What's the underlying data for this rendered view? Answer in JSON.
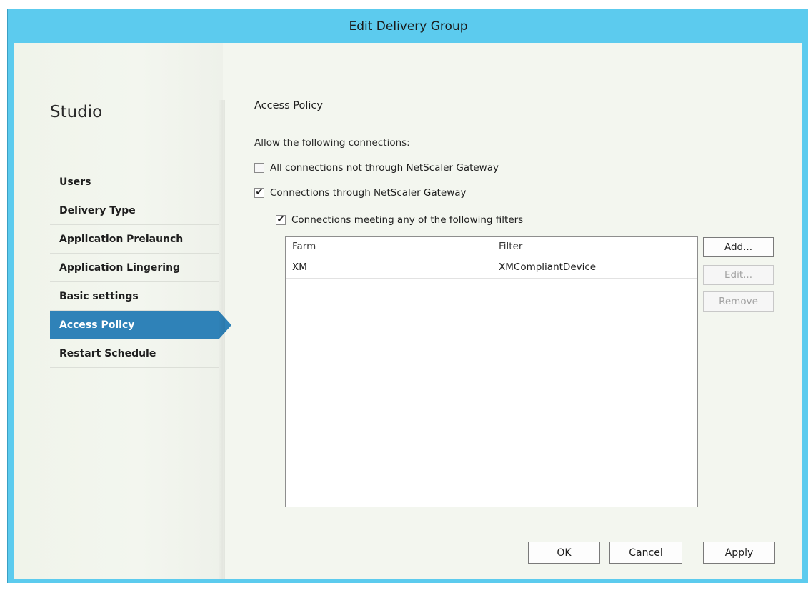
{
  "window": {
    "title": "Edit Delivery Group"
  },
  "sidebar": {
    "brand": "Studio",
    "items": [
      {
        "label": "Users"
      },
      {
        "label": "Delivery Type"
      },
      {
        "label": "Application Prelaunch"
      },
      {
        "label": "Application Lingering"
      },
      {
        "label": "Basic settings"
      },
      {
        "label": "Access Policy",
        "active": true
      },
      {
        "label": "Restart Schedule"
      }
    ]
  },
  "main": {
    "title": "Access Policy",
    "intro": "Allow the following connections:",
    "options": [
      {
        "label": "All connections not through NetScaler Gateway",
        "checked": false
      },
      {
        "label": "Connections through NetScaler Gateway",
        "checked": true
      },
      {
        "label": "Connections meeting any of the following filters",
        "checked": true
      }
    ],
    "table": {
      "columns": [
        "Farm",
        "Filter"
      ],
      "rows": [
        {
          "farm": "XM",
          "filter": "XMCompliantDevice"
        }
      ]
    },
    "buttons": {
      "add": "Add...",
      "edit": "Edit...",
      "remove": "Remove"
    }
  },
  "footer": {
    "ok": "OK",
    "cancel": "Cancel",
    "apply": "Apply"
  },
  "colors": {
    "titlebar": "#5ccbee",
    "active_nav": "#2f82b8",
    "client_bg": "#f3f6ef"
  },
  "icons": {
    "checkmark": "check-icon"
  }
}
